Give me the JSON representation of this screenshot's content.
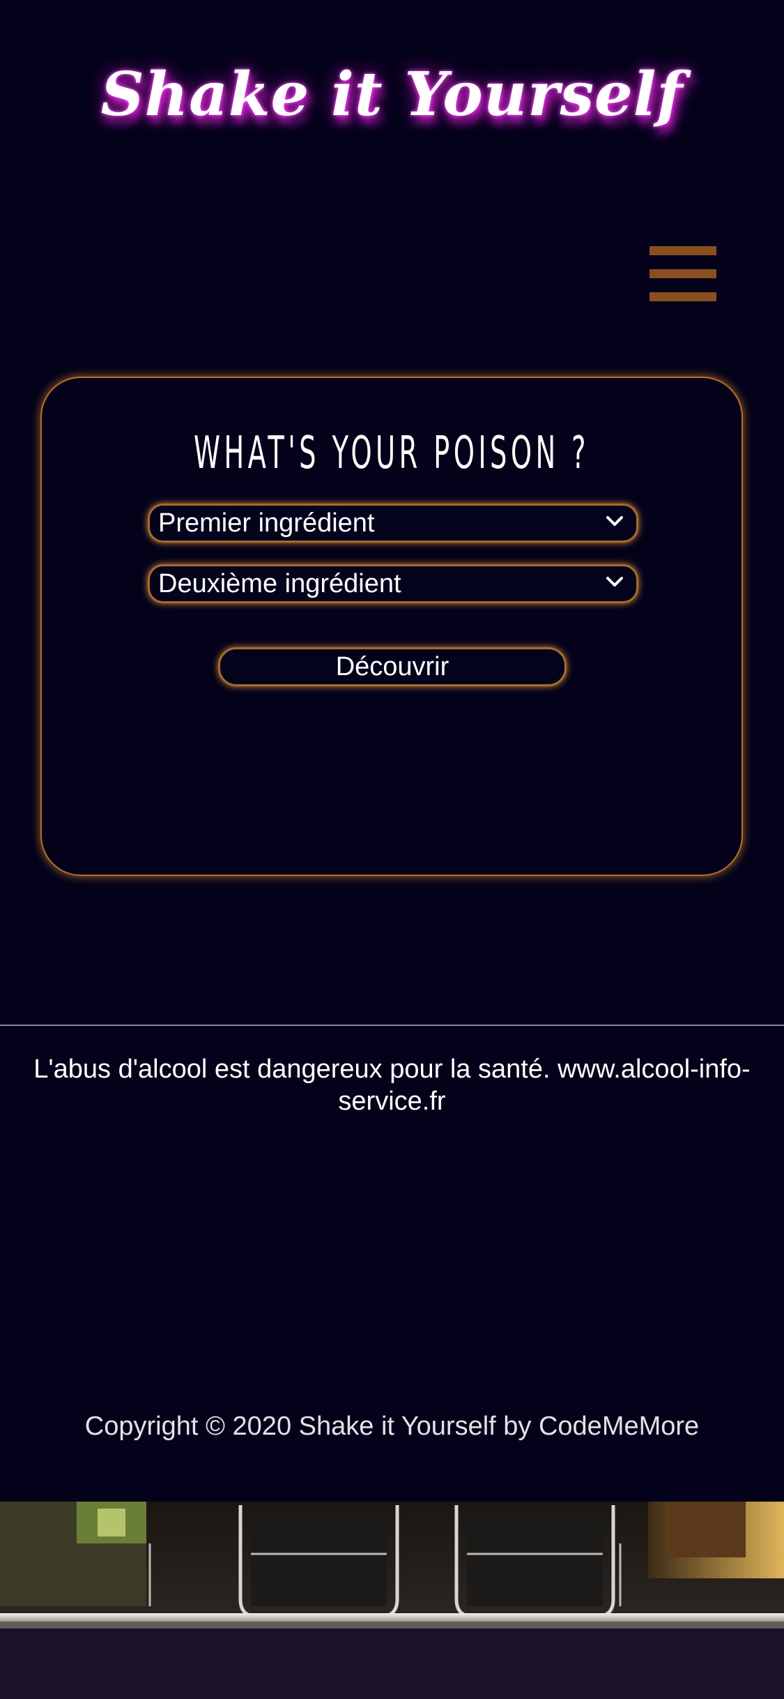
{
  "header": {
    "site_title": "Shake it Yourself"
  },
  "nav": {
    "menu_icon": "hamburger-menu-icon"
  },
  "poison_form": {
    "title": "WHAT'S YOUR POISON ?",
    "first_ingredient_value": "Premier ingrédient",
    "second_ingredient_value": "Deuxième ingrédient",
    "submit_label": "Découvrir"
  },
  "footer": {
    "health_warning": "L'abus d'alcool est dangereux pour la santé. www.alcool-info-service.fr",
    "copyright": "Copyright © 2020 Shake it Yourself by CodeMeMore"
  },
  "colors": {
    "background": "#03021a",
    "accent_border": "#b4702a",
    "menu_icon": "#8a4f1f",
    "title_glow": "#c21dc2"
  }
}
